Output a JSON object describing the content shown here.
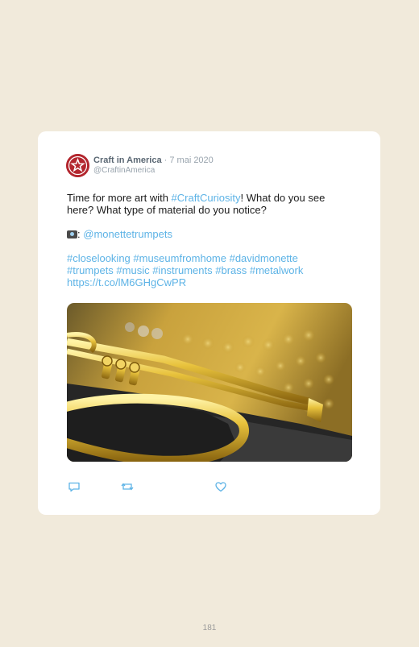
{
  "tweet": {
    "author": "Craft in America",
    "separator": "·",
    "date": "7 mai 2020",
    "handle": "@CraftinAmerica",
    "text_prefix": "Time for more art with ",
    "hashtag_main": "#CraftCuriosity",
    "text_suffix": "! What do you see here? What type of material do you notice?",
    "credit_sep": ":",
    "credit_mention": "@monettetrumpets",
    "hashtags_lines": [
      "#closelooking #museumfromhome #davidmonette",
      "#trumpets #music #instruments #brass #metalwork"
    ],
    "url": "https://t.co/lM6GHgCwPR",
    "icons": {
      "avatar": "craft-in-america-star-logo",
      "credit": "camera-icon",
      "reply": "reply-icon",
      "retweet": "retweet-icon",
      "like": "heart-icon"
    }
  },
  "page_number": "181",
  "colors": {
    "background": "#f1eadb",
    "card": "#ffffff",
    "link": "#5db3e6",
    "avatar": "#b3262e",
    "icon": "#5db3e6"
  }
}
